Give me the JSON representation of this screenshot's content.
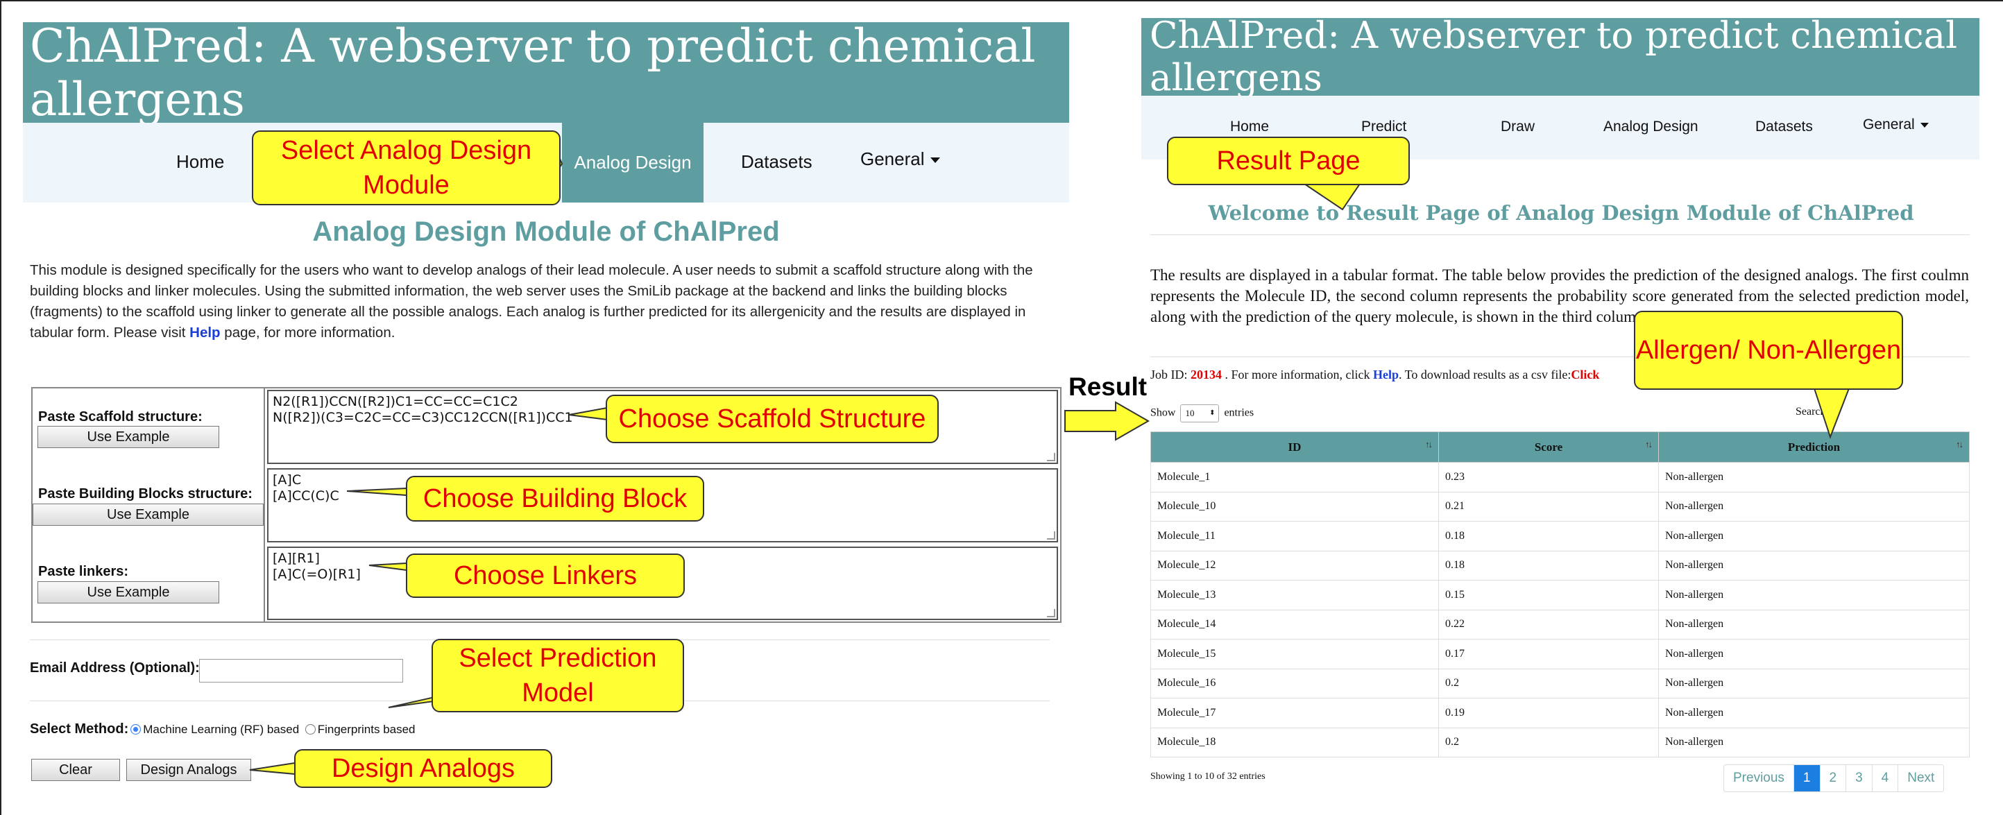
{
  "left": {
    "banner_title": "ChAlPred: A webserver to predict chemical allergens",
    "nav": {
      "home": "Home",
      "analog_design": "Analog Design",
      "datasets": "Datasets",
      "general": "General"
    },
    "page_title": "Analog Design Module of ChAlPred",
    "description_before": "This module is designed specifically for the users who want to develop analogs of their lead molecule. A user needs to submit a scaffold structure along with the building blocks and linker molecules. Using the submitted information, the web server uses the SmiLib package at the backend and links the building blocks (fragments) to the scaffold using linker to generate all the possible analogs. Each analog is further predicted for its allergenicity and the results are displayed in tabular form. Please visit ",
    "description_link": "Help",
    "description_after": " page, for more information.",
    "form": {
      "scaffold_label": "Paste Scaffold structure:",
      "scaffold_button": "Use Example",
      "scaffold_value": "N2([R1])CCN([R2])C1=CC=CC=C1C2\nN([R2])(C3=C2C=CC=C3)CC12CCN([R1])CC1",
      "blocks_label": "Paste Building Blocks structure:",
      "blocks_button": "Use Example",
      "blocks_value": "[A]C\n[A]CC(C)C",
      "linkers_label": "Paste linkers:",
      "linkers_button": "Use Example",
      "linkers_value": "[A][R1]\n[A]C(=O)[R1]",
      "email_label": "Email Address (Optional):",
      "method_label": "Select Method:",
      "method_option_1": "Machine Learning (RF) based",
      "method_option_2": "Fingerprints based",
      "clear_button": "Clear",
      "submit_button": "Design Analogs"
    }
  },
  "callouts": {
    "select_module": "Select Analog Design Module",
    "scaffold": "Choose Scaffold Structure",
    "building_block": "Choose Building Block",
    "linkers": "Choose Linkers",
    "prediction_model": "Select Prediction Model",
    "design": "Design Analogs",
    "result_page": "Result Page",
    "allergen": "Allergen/ Non-Allergen",
    "result_arrow_label": "Result"
  },
  "right": {
    "banner_title": "ChAlPred: A webserver to predict chemical allergens",
    "nav": {
      "home": "Home",
      "predict": "Predict",
      "draw": "Draw",
      "analog_design": "Analog Design",
      "datasets": "Datasets",
      "general": "General"
    },
    "welcome": "Welcome to Result Page of Analog Design Module of ChAlPred",
    "description": "The results are displayed in a tabular format. The table below provides the prediction of the designed analogs. The first coulmn represents the Molecule ID, the second column represents the probability score generated from the selected prediction model, along with the prediction of the query molecule, is shown in the third column.",
    "job": {
      "prefix": "Job ID: ",
      "id": "20134",
      "middle": " . For more information, click ",
      "help": "Help",
      "suffix": ". To download results as a csv file:",
      "click": "Click"
    },
    "show_prefix": "Show",
    "show_value": "10",
    "show_suffix": "entries",
    "search_label": "Search:",
    "table": {
      "headers": [
        "ID",
        "Score",
        "Prediction"
      ],
      "rows": [
        [
          "Molecule_1",
          "0.23",
          "Non-allergen"
        ],
        [
          "Molecule_10",
          "0.21",
          "Non-allergen"
        ],
        [
          "Molecule_11",
          "0.18",
          "Non-allergen"
        ],
        [
          "Molecule_12",
          "0.18",
          "Non-allergen"
        ],
        [
          "Molecule_13",
          "0.15",
          "Non-allergen"
        ],
        [
          "Molecule_14",
          "0.22",
          "Non-allergen"
        ],
        [
          "Molecule_15",
          "0.17",
          "Non-allergen"
        ],
        [
          "Molecule_16",
          "0.2",
          "Non-allergen"
        ],
        [
          "Molecule_17",
          "0.19",
          "Non-allergen"
        ],
        [
          "Molecule_18",
          "0.2",
          "Non-allergen"
        ]
      ]
    },
    "info": "Showing 1 to 10 of 32 entries",
    "pagination": {
      "previous": "Previous",
      "pages": [
        "1",
        "2",
        "3",
        "4"
      ],
      "next": "Next"
    }
  },
  "colors": {
    "teal": "#5f9ea0",
    "callout_fill": "#ffff33",
    "callout_text": "#e00000",
    "nav_bg": "#eef5fb",
    "link_blue": "#1a3fd6",
    "page_active": "#1a7fe0"
  }
}
